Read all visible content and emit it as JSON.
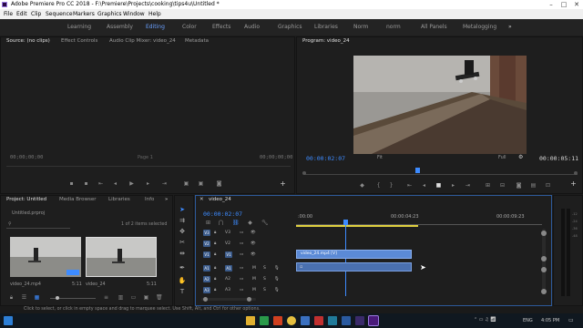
{
  "titlebar": {
    "title": "Adobe Premiere Pro CC 2018 - F:\\Premiere\\Projects\\cooking\\tips4u\\Untitled *"
  },
  "menu": [
    "File",
    "Edit",
    "Clip",
    "Sequence",
    "Markers",
    "Graphics",
    "Window",
    "Help"
  ],
  "workspaces": [
    "Learning",
    "Assembly",
    "Editing",
    "Color",
    "Effects",
    "Audio",
    "Graphics",
    "Libraries",
    "Norm",
    "norm",
    "All Panels",
    "Metalogging"
  ],
  "workspace_active": "Editing",
  "source_panel": {
    "tabs": [
      "Source: (no clips)",
      "Effect Controls",
      "Audio Clip Mixer: video_24",
      "Metadata"
    ],
    "timecode_left": "00;00;00;00",
    "page": "Page 1",
    "timecode_right": "00;00;00;00"
  },
  "program_panel": {
    "tab": "Program: video_24",
    "timecode": "00:00:02:07",
    "fit": "Fit",
    "quality": "Full",
    "duration": "00:00:05:11"
  },
  "project_panel": {
    "tabs": [
      "Project: Untitled",
      "Media Browser",
      "Libraries",
      "Info"
    ],
    "file": "Untitled.prproj",
    "selection": "1 of 2 items selected",
    "thumbs": [
      {
        "name": "video_24.mp4",
        "dur": "5:11"
      },
      {
        "name": "video_24",
        "dur": "5:11"
      }
    ]
  },
  "timeline": {
    "tab": "video_24",
    "timecode": "00:00:02:07",
    "ruler": [
      ":00:00",
      "00:00:04:23",
      "00:00:09:23"
    ],
    "video_tracks": [
      "V3",
      "V2",
      "V1"
    ],
    "audio_tracks": [
      "A1",
      "A2",
      "A3"
    ],
    "clip_label": "video_24.mp4 [V]"
  },
  "status": {
    "text": "Click to select, or click in empty space and drag to marquee select. Use Shift, Alt, and Ctrl for other options."
  },
  "taskbar": {
    "lang": "ENG",
    "time": "4:05 PM"
  },
  "colors": {
    "accent": "#3d8bff",
    "clip": "#5b8ad6",
    "playhead": "#3d8bff"
  }
}
